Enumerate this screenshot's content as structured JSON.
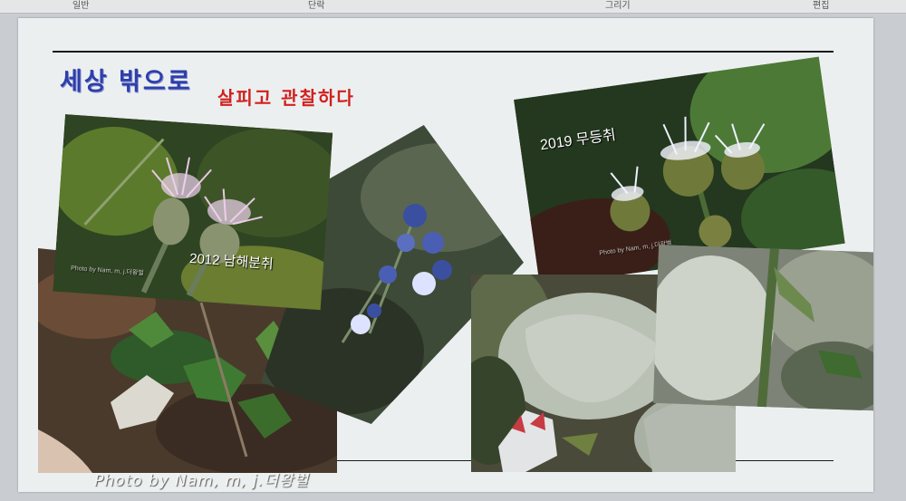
{
  "app_tabs": [
    "일반",
    "단락",
    "그리기",
    "편집"
  ],
  "slide": {
    "title": "세상 밖으로",
    "subtitle": "살피고 관찰하다"
  },
  "photos": {
    "leaf_litter": {
      "caption": ""
    },
    "purple_flowers": {
      "caption": ""
    },
    "namhae": {
      "caption": "2012 남해분취",
      "credit": "Photo by Nam, m, j.더왕벌"
    },
    "mudeung": {
      "caption": "2019 무등취",
      "credit": "Photo by Nam, m, j.더왕벌"
    },
    "big_leaf": {
      "caption": ""
    },
    "stem": {
      "caption": ""
    }
  },
  "footer_credit": "Photo by Nam, m, j.더왕벌",
  "colors": {
    "title": "#2e3fa8",
    "subtitle": "#d0211e",
    "slide_bg": "#eceff0"
  }
}
